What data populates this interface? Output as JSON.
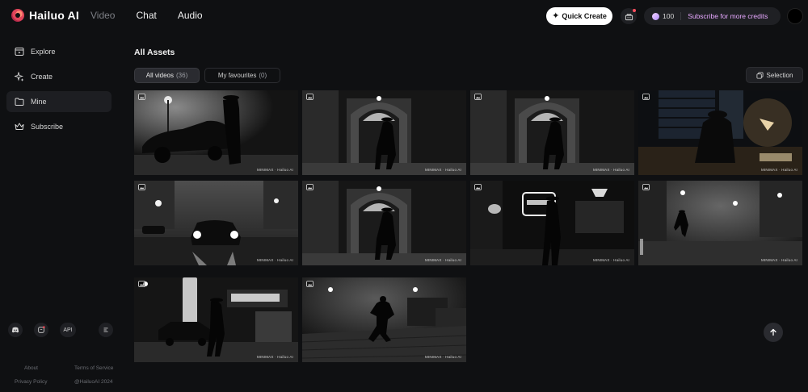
{
  "app": {
    "name": "Hailuo AI"
  },
  "topnav": [
    "Video",
    "Chat",
    "Audio"
  ],
  "header": {
    "quick_create": "Quick Create",
    "credits": "100",
    "subscribe": "Subscribe for more credits"
  },
  "sidebar": {
    "items": [
      {
        "label": "Explore",
        "icon": "explore-icon"
      },
      {
        "label": "Create",
        "icon": "sparkle-icon"
      },
      {
        "label": "Mine",
        "icon": "folder-icon"
      },
      {
        "label": "Subscribe",
        "icon": "crown-icon"
      }
    ],
    "active_index": 2,
    "bottom": {
      "api_label": "API"
    },
    "footer": {
      "about": "About",
      "terms": "Terms of Service",
      "privacy": "Privacy Policy",
      "copyright": "@HailuoAI 2024"
    }
  },
  "main": {
    "title": "All Assets",
    "tabs": [
      {
        "label": "All videos",
        "count": "(36)",
        "active": true
      },
      {
        "label": "My favourites",
        "count": "(0)",
        "active": false
      }
    ],
    "selection_label": "Selection",
    "watermark": "MINIMAX · Hailuo AI",
    "videos": [
      {
        "scene": "vintage-car-street-fog"
      },
      {
        "scene": "arched-doorway-figure"
      },
      {
        "scene": "arched-doorway-figure"
      },
      {
        "scene": "desk-lamp-office"
      },
      {
        "scene": "car-headlights-fog-street"
      },
      {
        "scene": "arched-doorway-figure"
      },
      {
        "scene": "nightclub-neon-sign"
      },
      {
        "scene": "running-man-foggy-street"
      },
      {
        "scene": "neon-sign-car-alley"
      },
      {
        "scene": "running-man-harbor"
      }
    ]
  },
  "colors": {
    "background": "#0f1012",
    "accent_subscribe": "#e7a8ff",
    "badge_red": "#ff4f5e"
  }
}
